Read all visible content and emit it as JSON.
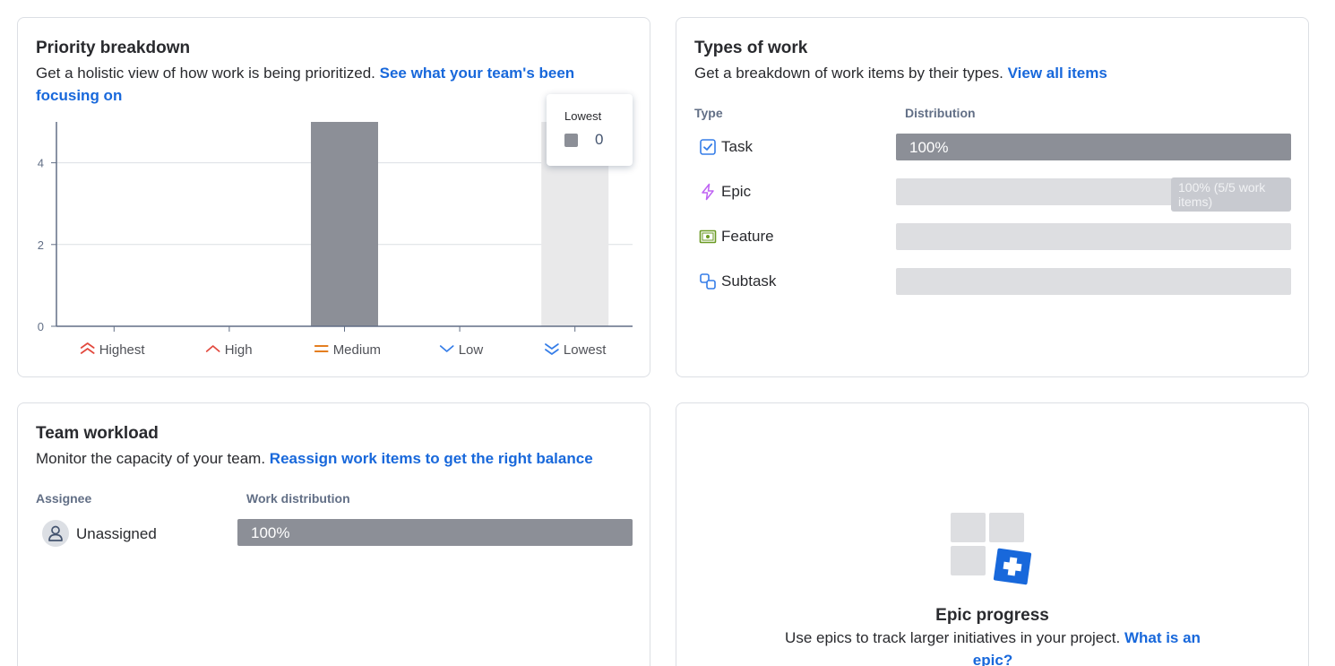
{
  "priority": {
    "title": "Priority breakdown",
    "description": "Get a holistic view of how work is being prioritized.",
    "link": "See what your team's been focusing on",
    "tooltip": {
      "label": "Lowest",
      "value": "0"
    }
  },
  "chart_data": {
    "type": "bar",
    "categories": [
      "Highest",
      "High",
      "Medium",
      "Low",
      "Lowest"
    ],
    "values": [
      0,
      0,
      5,
      0,
      5
    ],
    "highlighted": [
      false,
      false,
      false,
      false,
      true
    ],
    "ylim": [
      0,
      5
    ],
    "yticks": [
      "0",
      "2",
      "4"
    ],
    "grid": true,
    "colors": {
      "bar": "#8c8f97",
      "bar_highlight": "#e9e9ea",
      "grid": "#dcdfe4",
      "axis": "#626f86"
    },
    "category_icons": [
      "highest-priority-icon",
      "high-priority-icon",
      "medium-priority-icon",
      "low-priority-icon",
      "lowest-priority-icon"
    ],
    "category_colors": [
      "#e2483d",
      "#e2483d",
      "#e06c00",
      "#357de8",
      "#357de8"
    ]
  },
  "types": {
    "title": "Types of work",
    "description": "Get a breakdown of work items by their types.",
    "link": "View all items",
    "col_type": "Type",
    "col_distribution": "Distribution",
    "rows": [
      {
        "label": "Task",
        "icon": "task-icon",
        "percent_text": "100%",
        "fill": 1.0
      },
      {
        "label": "Epic",
        "icon": "epic-icon",
        "percent_text": "",
        "fill": 0.0,
        "tooltip": "100% (5/5 work items)"
      },
      {
        "label": "Feature",
        "icon": "feature-icon",
        "percent_text": "",
        "fill": 0.0
      },
      {
        "label": "Subtask",
        "icon": "subtask-icon",
        "percent_text": "",
        "fill": 0.0
      }
    ]
  },
  "workload": {
    "title": "Team workload",
    "description": "Monitor the capacity of your team.",
    "link": "Reassign work items to get the right balance",
    "col_assignee": "Assignee",
    "col_distribution": "Work distribution",
    "rows": [
      {
        "label": "Unassigned",
        "icon": "person-icon",
        "percent_text": "100%",
        "fill": 1.0
      }
    ]
  },
  "epic": {
    "title": "Epic progress",
    "description": "Use epics to track larger initiatives in your project.",
    "link": "What is an epic?"
  }
}
